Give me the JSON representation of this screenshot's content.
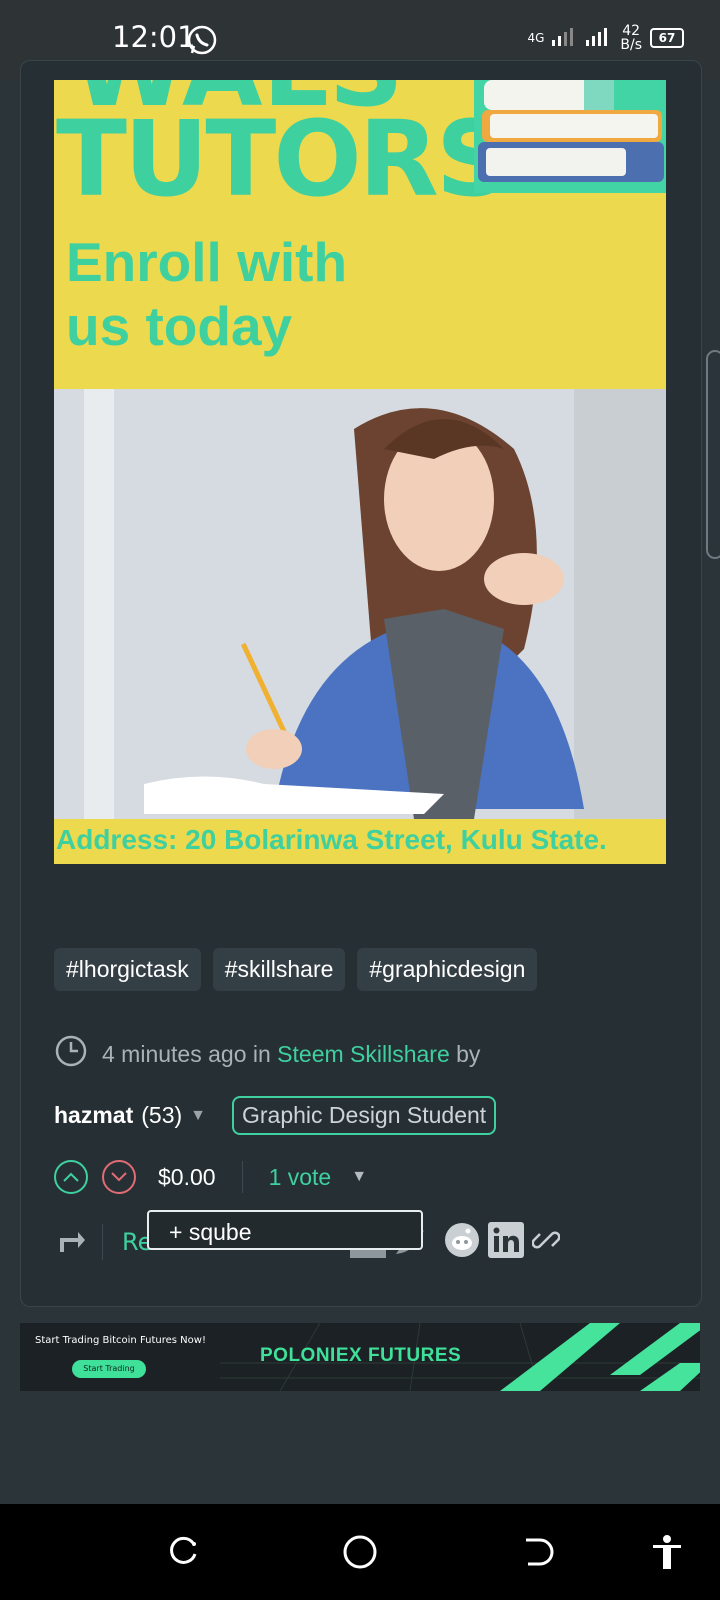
{
  "status_bar": {
    "time": "12:01",
    "net_gen": "4G",
    "net_speed_value": "42",
    "net_speed_unit": "B/s",
    "battery": "67"
  },
  "post_image": {
    "title_clip": "WALS",
    "title": "TUTORS",
    "tagline_1": "Enroll with",
    "tagline_2": "us today",
    "address": "Address: 20 Bolarinwa Street, Kulu State."
  },
  "tags": [
    "#lhorgictask",
    "#skillshare",
    "#graphicdesign"
  ],
  "meta": {
    "time_ago": "4 minutes ago",
    "in_word": "in",
    "community": "Steem Skillshare",
    "by_word": "by"
  },
  "author": {
    "name": "hazmat",
    "reputation": "(53)",
    "role": "Graphic Design Student"
  },
  "votes": {
    "payout": "$0.00",
    "count": "1 vote"
  },
  "share": {
    "reblog_label": "Re",
    "tooltip": "+ sqube"
  },
  "ad": {
    "text": "Start Trading Bitcoin Futures Now!",
    "cta": "Start Trading",
    "brand": "POLONIEX  FUTURES"
  },
  "colors": {
    "accent": "#3fd0a0",
    "banner_yellow": "#ecd94e",
    "background": "#2b3438"
  }
}
